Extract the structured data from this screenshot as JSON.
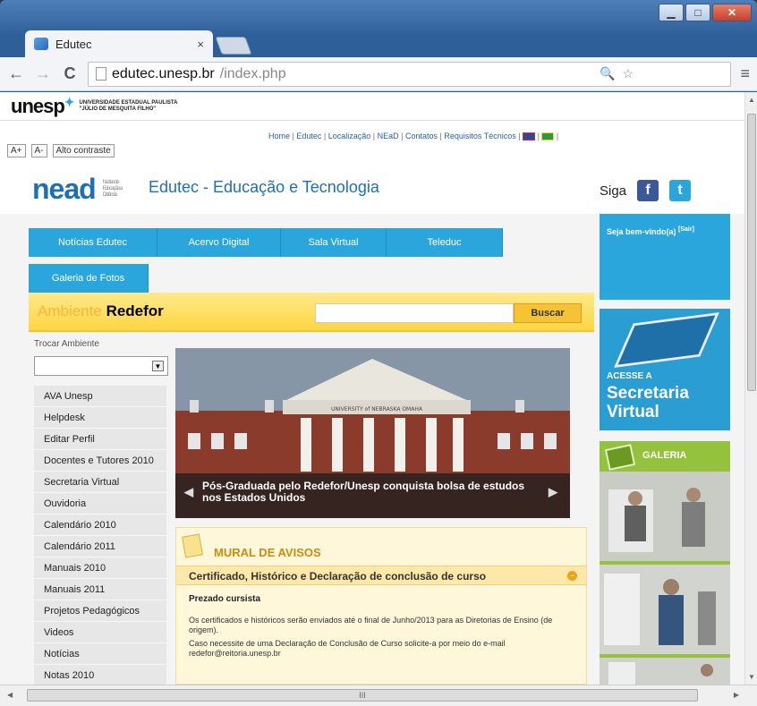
{
  "browser": {
    "tab_title": "Edutec",
    "tab_close": "×",
    "url_host": "edutec.unesp.br",
    "url_path": "/index.php",
    "back": "←",
    "forward": "→",
    "reload": "C",
    "menu": "≡",
    "zoom": "🔍",
    "star": "☆"
  },
  "unesp": {
    "logo": "unesp",
    "sub1": "UNIVERSIDADE ESTADUAL PAULISTA",
    "sub2": "\"JÚLIO DE MESQUITA FILHO\""
  },
  "accessibility": [
    "A+",
    "A-",
    "Alto contraste"
  ],
  "topnav": [
    "Home",
    "Edutec",
    "Localização",
    "NEaD",
    "Contatos",
    "Requisitos Técnicos"
  ],
  "brand": {
    "logo": "nead",
    "logo_sub": "Núcleo de Educação a Distância",
    "title": "Edutec - Educação e Tecnologia",
    "siga": "Siga",
    "facebook": "f",
    "twitter": "t"
  },
  "mainnav": [
    "Notícias Edutec",
    "Acervo Digital",
    "Sala Virtual",
    "Teleduc",
    "Galeria de Fotos"
  ],
  "ambiente": {
    "prefix": "Ambiente",
    "name": "Redefor",
    "search_button": "Buscar"
  },
  "sidebar": {
    "label": "Trocar Ambiente",
    "items": [
      "AVA Unesp",
      "Helpdesk",
      "Editar Perfil",
      "Docentes e Tutores 2010",
      "Secretaria Virtual",
      "Ouvidoria",
      "Calendário 2010",
      "Calendário 2011",
      "Manuais 2010",
      "Manuais 2011",
      "Projetos Pedagógicos",
      "Videos",
      "Notícias",
      "Notas 2010"
    ]
  },
  "slide": {
    "sign": "UNIVERSITY of NEBRASKA OMAHA",
    "caption": "Pós-Graduada pelo Redefor/Unesp conquista bolsa de estudos nos Estados Unidos"
  },
  "mural": {
    "title": "MURAL DE AVISOS",
    "item_title": "Certificado, Histórico e Declaração de conclusão de curso",
    "greeting": "Prezado cursista",
    "p1": "Os certificados e históricos serão enviados até o final de Junho/2013 para as Diretorias de Ensino (de origem).",
    "p2": "Caso necessite de uma Declaração de Conclusão de Curso solicite-a por meio do e-mail redefor@reitoria.unesp.br"
  },
  "right": {
    "welcome": "Seja bem-vindo(a)",
    "sair": "[Sair]",
    "acesse": "ACESSE A",
    "secretaria": "Secretaria Virtual",
    "galeria": "GALERIA"
  },
  "scroll": {
    "hthumb": "III"
  }
}
